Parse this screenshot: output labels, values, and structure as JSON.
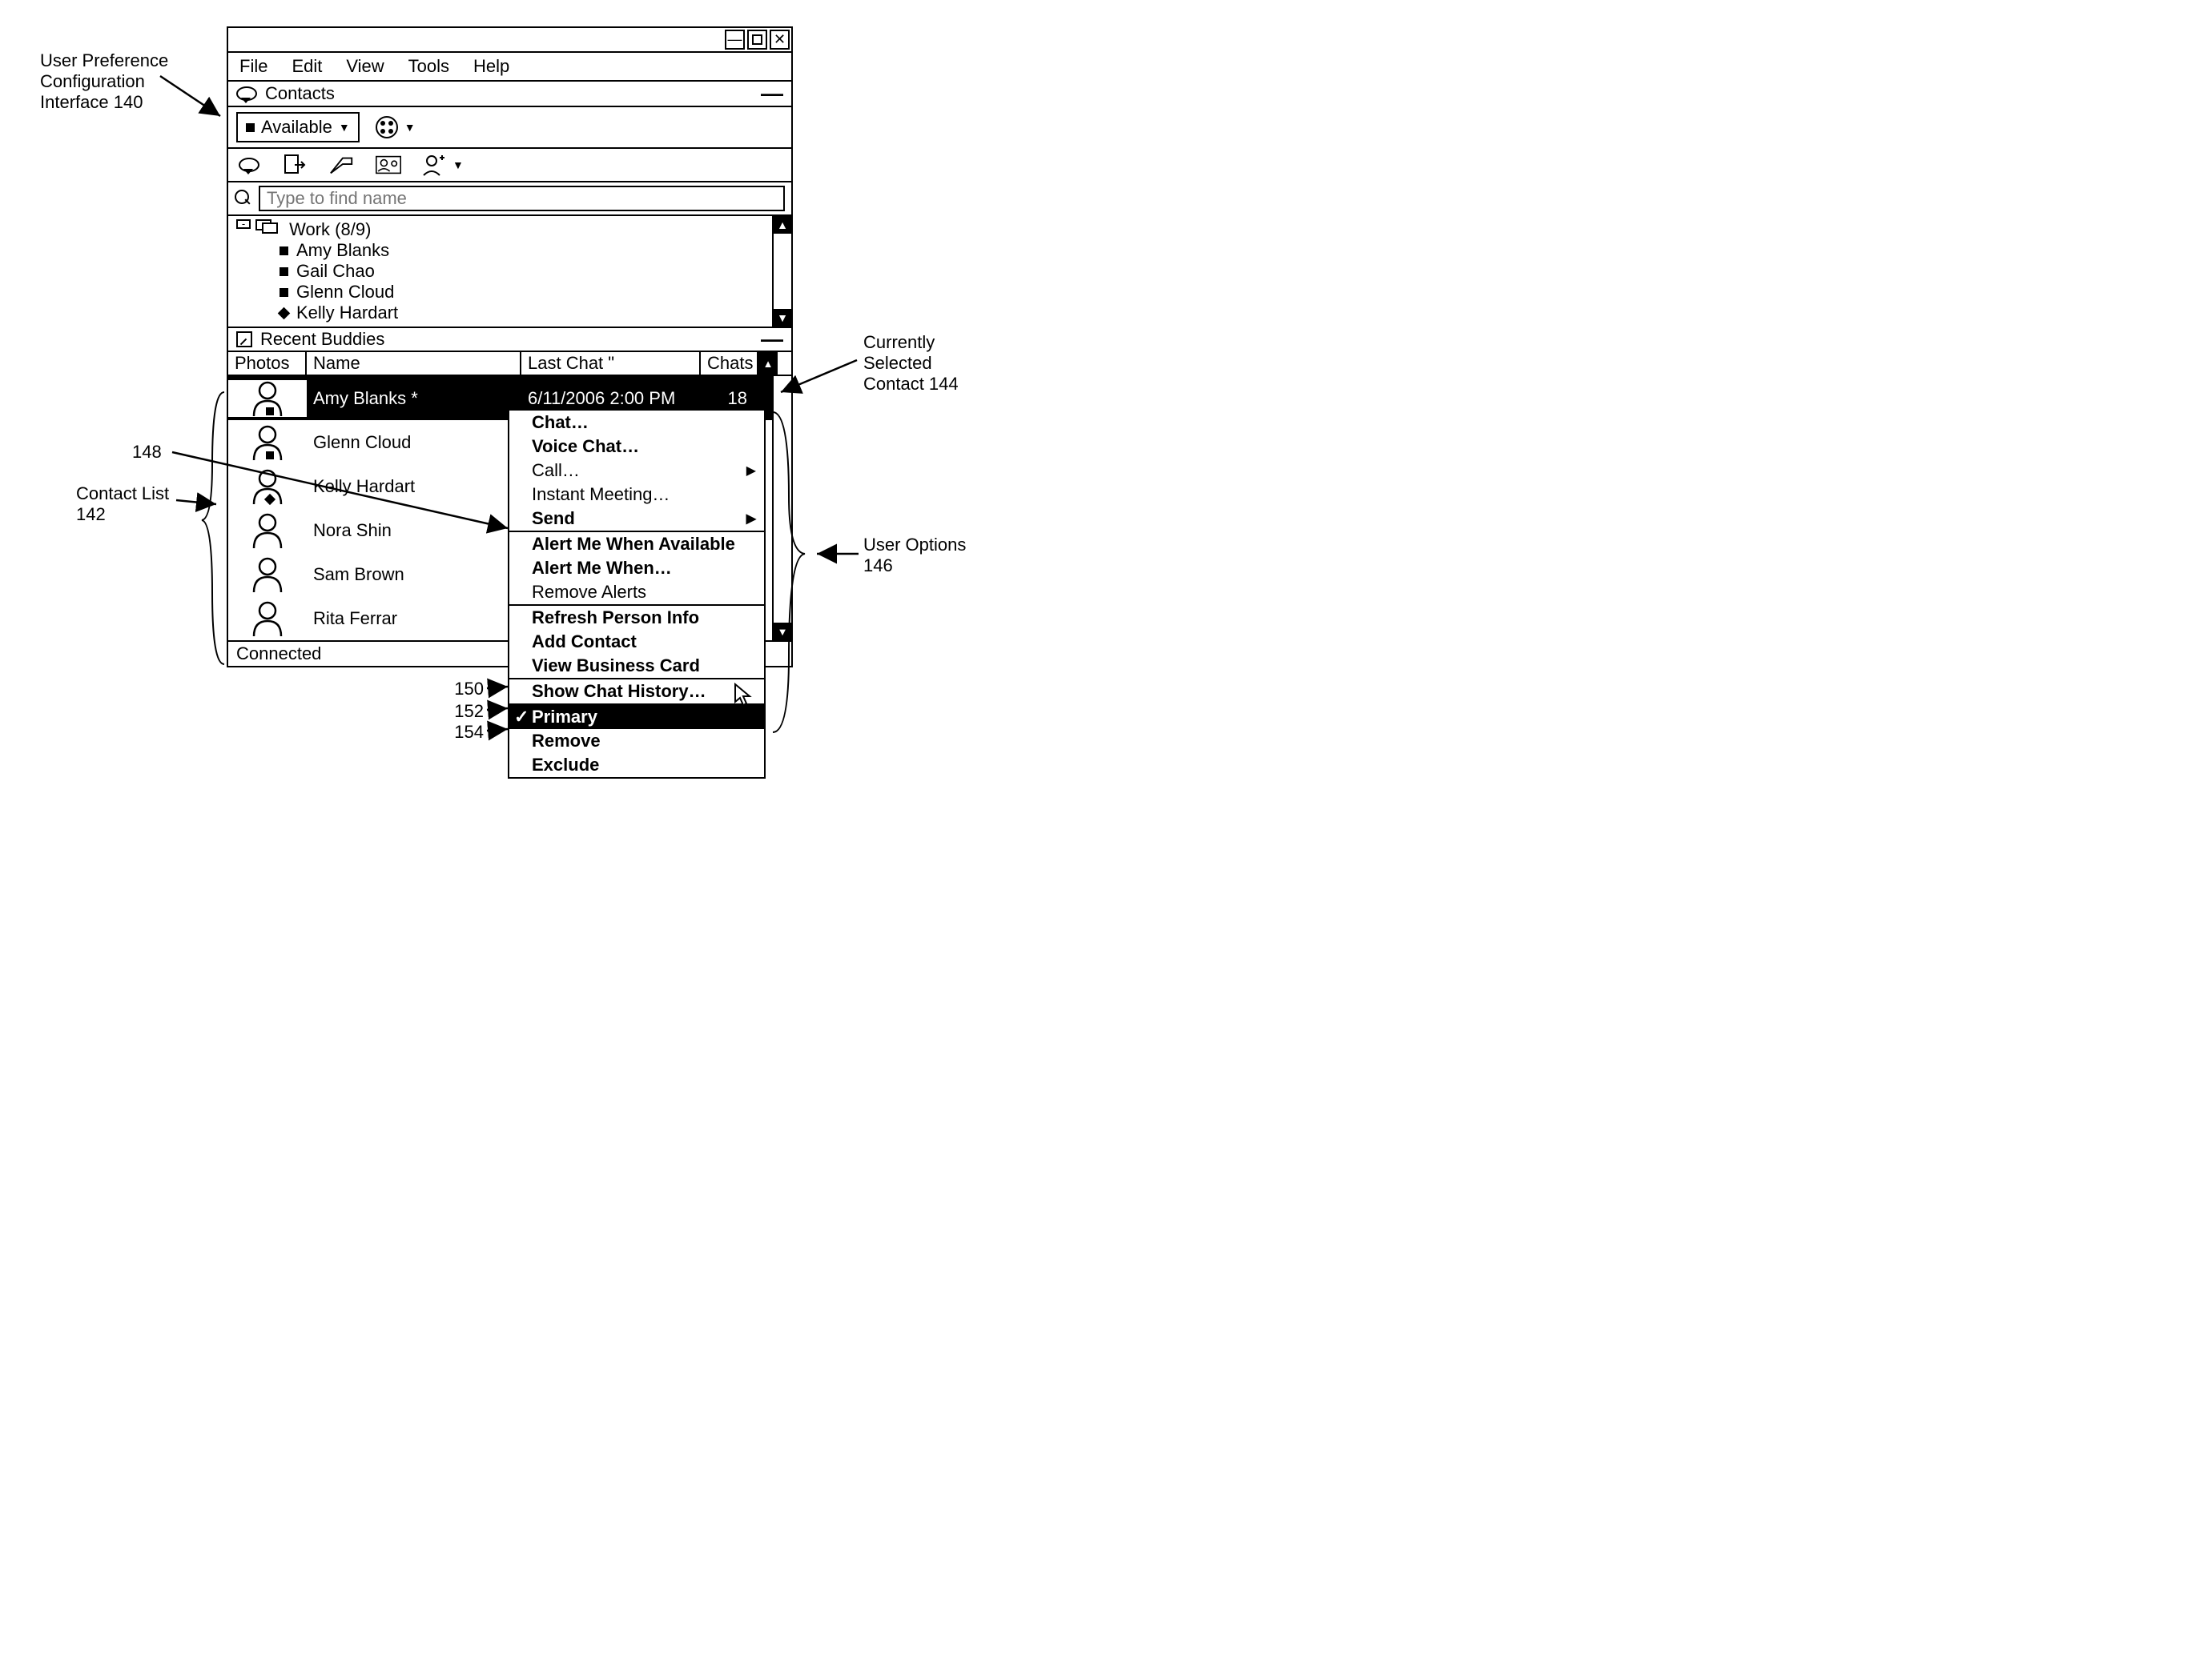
{
  "callouts": {
    "ui_label_1": "User Preference",
    "ui_label_2": "Configuration",
    "ui_label_3": "Interface 140",
    "contact_list_1": "Contact List",
    "contact_list_2": "142",
    "selected_1": "Currently",
    "selected_2": "Selected",
    "selected_3": "Contact 144",
    "user_options_1": "User Options",
    "user_options_2": "146",
    "ref148": "148",
    "ref150": "150",
    "ref152": "152",
    "ref154": "154"
  },
  "menu": {
    "file": "File",
    "edit": "Edit",
    "view": "View",
    "tools": "Tools",
    "help": "Help"
  },
  "contacts_header": {
    "label": "Contacts"
  },
  "status": {
    "label": "Available"
  },
  "search": {
    "placeholder": "Type to find name"
  },
  "work_group": {
    "title": "Work (8/9)",
    "items": [
      {
        "name": "Amy Blanks",
        "shape": "sq"
      },
      {
        "name": "Gail Chao",
        "shape": "sq"
      },
      {
        "name": "Glenn Cloud",
        "shape": "sq"
      },
      {
        "name": "Kelly Hardart",
        "shape": "di"
      }
    ]
  },
  "recent_buddies": {
    "header": "Recent Buddies",
    "columns": {
      "photos": "Photos",
      "name": "Name",
      "last": "Last Chat \"",
      "chats": "Chats"
    },
    "rows": [
      {
        "name": "Amy Blanks *",
        "last": "6/11/2006 2:00 PM",
        "chats": "18",
        "status": "sq",
        "selected": true
      },
      {
        "name": "Glenn Cloud",
        "last": "",
        "chats": "",
        "status": "sq",
        "selected": false
      },
      {
        "name": "Kelly Hardart",
        "last": "",
        "chats": "",
        "status": "di",
        "selected": false
      },
      {
        "name": "Nora Shin",
        "last": "",
        "chats": "",
        "status": "",
        "selected": false
      },
      {
        "name": "Sam Brown",
        "last": "",
        "chats": "",
        "status": "",
        "selected": false
      },
      {
        "name": "Rita Ferrar",
        "last": "",
        "chats": "",
        "status": "",
        "selected": false
      }
    ]
  },
  "statusbar": {
    "text": "Connected"
  },
  "context_menu": {
    "groups": [
      [
        {
          "label": "Chat…",
          "bold": true,
          "submenu": false
        },
        {
          "label": "Voice Chat…",
          "bold": true,
          "submenu": false
        },
        {
          "label": "Call…",
          "bold": false,
          "submenu": true
        },
        {
          "label": "Instant Meeting…",
          "bold": false,
          "submenu": false
        },
        {
          "label": "Send",
          "bold": true,
          "submenu": true
        }
      ],
      [
        {
          "label": "Alert Me When Available",
          "bold": true,
          "submenu": false
        },
        {
          "label": "Alert Me When…",
          "bold": true,
          "submenu": false
        },
        {
          "label": "Remove Alerts",
          "bold": false,
          "submenu": false
        }
      ],
      [
        {
          "label": "Refresh Person Info",
          "bold": true,
          "submenu": false
        },
        {
          "label": "Add Contact",
          "bold": true,
          "submenu": false
        },
        {
          "label": "View Business Card",
          "bold": true,
          "submenu": false
        }
      ],
      [
        {
          "label": "Show Chat History…",
          "bold": true,
          "submenu": false
        }
      ],
      [
        {
          "label": "Primary",
          "bold": true,
          "submenu": false,
          "selected": true
        },
        {
          "label": "Remove",
          "bold": true,
          "submenu": false
        },
        {
          "label": "Exclude",
          "bold": true,
          "submenu": false
        }
      ]
    ]
  }
}
